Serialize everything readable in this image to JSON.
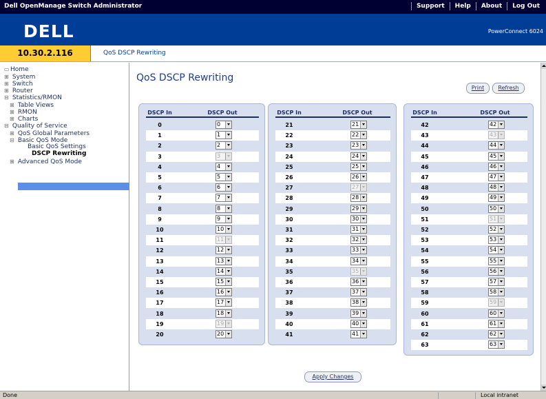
{
  "header": {
    "app_title": "Dell OpenManage Switch Administrator",
    "links": [
      "Support",
      "Help",
      "About",
      "Log Out"
    ],
    "logo": "DELL",
    "product": "PowerConnect 6024"
  },
  "ip_bar": {
    "ip": "10.30.2.116",
    "breadcrumb": "QoS DSCP Rewriting"
  },
  "sidebar": {
    "items": [
      {
        "label": "Home",
        "expander": ""
      },
      {
        "label": "System",
        "expander": "⊞"
      },
      {
        "label": "Switch",
        "expander": "⊞"
      },
      {
        "label": "Router",
        "expander": "⊞"
      },
      {
        "label": "Statistics/RMON",
        "expander": "⊟"
      },
      {
        "label": "Table Views",
        "expander": "⊞"
      },
      {
        "label": "RMON",
        "expander": "⊞"
      },
      {
        "label": "Charts",
        "expander": "⊞"
      },
      {
        "label": "Quality of Service",
        "expander": "⊟"
      },
      {
        "label": "QoS Global Parameters",
        "expander": "⊞"
      },
      {
        "label": "Basic QoS Mode",
        "expander": "⊟"
      },
      {
        "label": "Basic QoS Settings",
        "expander": ""
      },
      {
        "label": "DSCP Rewriting",
        "expander": ""
      },
      {
        "label": "Advanced QoS Mode",
        "expander": "⊞"
      }
    ]
  },
  "main": {
    "title": "QoS DSCP Rewriting",
    "print_label": "Print",
    "refresh_label": "Refresh",
    "apply_label": "Apply Changes",
    "col_in": "DSCP In",
    "col_out": "DSCP Out"
  },
  "dscp": {
    "columns": [
      {
        "rows": [
          {
            "in": "0",
            "out": "0",
            "disabled": false
          },
          {
            "in": "1",
            "out": "1",
            "disabled": false
          },
          {
            "in": "2",
            "out": "2",
            "disabled": false
          },
          {
            "in": "3",
            "out": "3",
            "disabled": true
          },
          {
            "in": "4",
            "out": "4",
            "disabled": false
          },
          {
            "in": "5",
            "out": "5",
            "disabled": false
          },
          {
            "in": "6",
            "out": "6",
            "disabled": false
          },
          {
            "in": "7",
            "out": "7",
            "disabled": false
          },
          {
            "in": "8",
            "out": "8",
            "disabled": false
          },
          {
            "in": "9",
            "out": "9",
            "disabled": false
          },
          {
            "in": "10",
            "out": "10",
            "disabled": false
          },
          {
            "in": "11",
            "out": "11",
            "disabled": true
          },
          {
            "in": "12",
            "out": "12",
            "disabled": false
          },
          {
            "in": "13",
            "out": "13",
            "disabled": false
          },
          {
            "in": "14",
            "out": "14",
            "disabled": false
          },
          {
            "in": "15",
            "out": "15",
            "disabled": false
          },
          {
            "in": "16",
            "out": "16",
            "disabled": false
          },
          {
            "in": "17",
            "out": "17",
            "disabled": false
          },
          {
            "in": "18",
            "out": "18",
            "disabled": false
          },
          {
            "in": "19",
            "out": "19",
            "disabled": true
          },
          {
            "in": "20",
            "out": "20",
            "disabled": false
          }
        ]
      },
      {
        "rows": [
          {
            "in": "21",
            "out": "21",
            "disabled": false
          },
          {
            "in": "22",
            "out": "22",
            "disabled": false
          },
          {
            "in": "23",
            "out": "23",
            "disabled": false
          },
          {
            "in": "24",
            "out": "24",
            "disabled": false
          },
          {
            "in": "25",
            "out": "25",
            "disabled": false
          },
          {
            "in": "26",
            "out": "26",
            "disabled": false
          },
          {
            "in": "27",
            "out": "27",
            "disabled": true
          },
          {
            "in": "28",
            "out": "28",
            "disabled": false
          },
          {
            "in": "29",
            "out": "29",
            "disabled": false
          },
          {
            "in": "30",
            "out": "30",
            "disabled": false
          },
          {
            "in": "31",
            "out": "31",
            "disabled": false
          },
          {
            "in": "32",
            "out": "32",
            "disabled": false
          },
          {
            "in": "33",
            "out": "33",
            "disabled": false
          },
          {
            "in": "34",
            "out": "34",
            "disabled": false
          },
          {
            "in": "35",
            "out": "35",
            "disabled": true
          },
          {
            "in": "36",
            "out": "36",
            "disabled": false
          },
          {
            "in": "37",
            "out": "37",
            "disabled": false
          },
          {
            "in": "38",
            "out": "38",
            "disabled": false
          },
          {
            "in": "39",
            "out": "39",
            "disabled": false
          },
          {
            "in": "40",
            "out": "40",
            "disabled": false
          },
          {
            "in": "41",
            "out": "41",
            "disabled": false
          }
        ]
      },
      {
        "rows": [
          {
            "in": "42",
            "out": "42",
            "disabled": false
          },
          {
            "in": "43",
            "out": "43",
            "disabled": true
          },
          {
            "in": "44",
            "out": "44",
            "disabled": false
          },
          {
            "in": "45",
            "out": "45",
            "disabled": false
          },
          {
            "in": "46",
            "out": "46",
            "disabled": false
          },
          {
            "in": "47",
            "out": "47",
            "disabled": false
          },
          {
            "in": "48",
            "out": "48",
            "disabled": false
          },
          {
            "in": "49",
            "out": "49",
            "disabled": false
          },
          {
            "in": "50",
            "out": "50",
            "disabled": false
          },
          {
            "in": "51",
            "out": "51",
            "disabled": true
          },
          {
            "in": "52",
            "out": "52",
            "disabled": false
          },
          {
            "in": "53",
            "out": "53",
            "disabled": false
          },
          {
            "in": "54",
            "out": "54",
            "disabled": false
          },
          {
            "in": "55",
            "out": "55",
            "disabled": false
          },
          {
            "in": "56",
            "out": "56",
            "disabled": false
          },
          {
            "in": "57",
            "out": "57",
            "disabled": false
          },
          {
            "in": "58",
            "out": "58",
            "disabled": false
          },
          {
            "in": "59",
            "out": "59",
            "disabled": true
          },
          {
            "in": "60",
            "out": "60",
            "disabled": false
          },
          {
            "in": "61",
            "out": "61",
            "disabled": false
          },
          {
            "in": "62",
            "out": "62",
            "disabled": false
          },
          {
            "in": "63",
            "out": "63",
            "disabled": false
          }
        ]
      }
    ]
  },
  "status": {
    "left": "Done",
    "zone": "Local intranet"
  }
}
